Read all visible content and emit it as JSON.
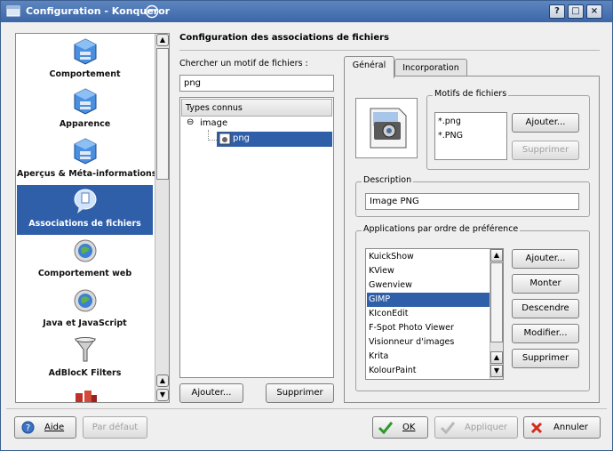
{
  "window": {
    "title": "Configuration - Konqueror"
  },
  "title_buttons": {
    "help": "?",
    "maximize": "□",
    "close": "×"
  },
  "sidebar": {
    "items": [
      {
        "label": "Comportement",
        "icon": "gear-icon"
      },
      {
        "label": "Apparence",
        "icon": "appearance-icon"
      },
      {
        "label": "Aperçus & Méta-informations",
        "icon": "preview-icon"
      },
      {
        "label": "Associations de fichiers",
        "icon": "file-association-icon",
        "selected": true
      },
      {
        "label": "Comportement web",
        "icon": "web-gear-icon"
      },
      {
        "label": "Java et JavaScript",
        "icon": "java-icon"
      },
      {
        "label": "AdBlocK Filters",
        "icon": "filter-icon"
      }
    ]
  },
  "main": {
    "header": "Configuration des associations de fichiers",
    "search_label": "Chercher un motif de fichiers :",
    "search_value": "png",
    "tree": {
      "column": "Types connus",
      "parent": "image",
      "parent_expander": "⊖",
      "child": "png"
    },
    "add_button": "Ajouter...",
    "remove_button": "Supprimer"
  },
  "tabs": [
    "Général",
    "Incorporation"
  ],
  "patterns": {
    "title": "Motifs de fichiers",
    "items": [
      "*.png",
      "*.PNG"
    ],
    "add_button": "Ajouter...",
    "remove_button": "Supprimer"
  },
  "description": {
    "title": "Description",
    "value": "Image PNG"
  },
  "applications": {
    "title": "Applications par ordre de préférence",
    "items": [
      "KuickShow",
      "KView",
      "Gwenview",
      "GIMP",
      "KIconEdit",
      "F-Spot Photo Viewer",
      "Visionneur d'images",
      "Krita",
      "KolourPaint"
    ],
    "selected_index": 3,
    "buttons": {
      "add": "Ajouter...",
      "up": "Monter",
      "down": "Descendre",
      "modify": "Modifier...",
      "remove": "Supprimer"
    }
  },
  "footer": {
    "help": "Aide",
    "default": "Par défaut",
    "ok": "OK",
    "apply": "Appliquer",
    "cancel": "Annuler"
  },
  "colors": {
    "selection": "#2f5fa8",
    "titlebar": "#4a74b4"
  }
}
